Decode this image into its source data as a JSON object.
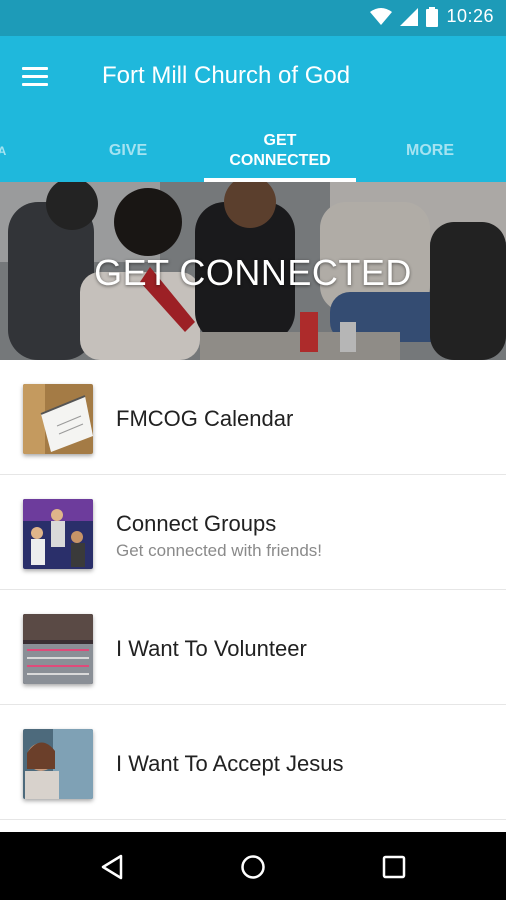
{
  "status_bar": {
    "time": "10:26"
  },
  "app_bar": {
    "title": "Fort Mill Church of God"
  },
  "tabs": [
    {
      "label": "A"
    },
    {
      "label": "GIVE"
    },
    {
      "label": "GET CONNECTED"
    },
    {
      "label": "MORE"
    }
  ],
  "hero": {
    "title": "GET CONNECTED"
  },
  "list": [
    {
      "title": "FMCOG Calendar",
      "subtitle": ""
    },
    {
      "title": "Connect Groups",
      "subtitle": "Get connected with friends!"
    },
    {
      "title": "I Want To Volunteer",
      "subtitle": ""
    },
    {
      "title": "I Want To Accept Jesus",
      "subtitle": ""
    }
  ],
  "colors": {
    "status_bar": "#1d9bb8",
    "app_bar": "#1fb8dc",
    "nav_bar": "#000000"
  },
  "icons": [
    "wifi-icon",
    "signal-icon",
    "battery-icon",
    "menu-icon",
    "back-icon",
    "home-icon",
    "recents-icon"
  ]
}
